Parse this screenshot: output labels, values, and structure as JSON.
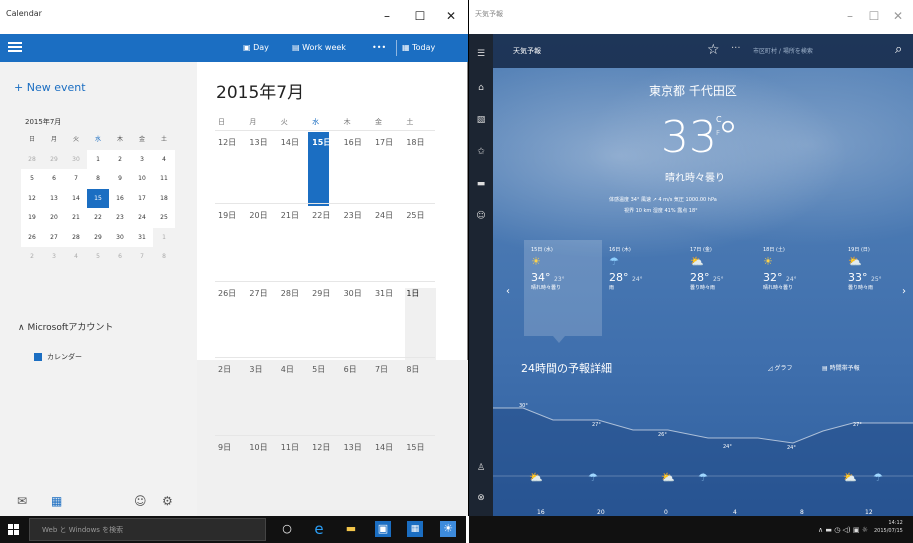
{
  "calendar": {
    "window_title": "Calendar",
    "toolbar": {
      "day": "Day",
      "work_week": "Work week",
      "more": "•••",
      "today": "Today"
    },
    "new_event": "+ New event",
    "mini_title": "2015年7月",
    "weekday_headers": [
      "日",
      "月",
      "火",
      "水",
      "木",
      "金",
      "土"
    ],
    "mini_rows": [
      [
        "28",
        "29",
        "30",
        "1",
        "2",
        "3",
        "4"
      ],
      [
        "5",
        "6",
        "7",
        "8",
        "9",
        "10",
        "11"
      ],
      [
        "12",
        "13",
        "14",
        "15",
        "16",
        "17",
        "18"
      ],
      [
        "19",
        "20",
        "21",
        "22",
        "23",
        "24",
        "25"
      ],
      [
        "26",
        "27",
        "28",
        "29",
        "30",
        "31",
        "1"
      ],
      [
        "2",
        "3",
        "4",
        "5",
        "6",
        "7",
        "8"
      ]
    ],
    "account": "Microsoftアカウント",
    "calendar_item": "カレンダー",
    "month_title": "2015年7月",
    "week_rows": [
      [
        "12日",
        "13日",
        "14日",
        "15日",
        "16日",
        "17日",
        "18日"
      ],
      [
        "19日",
        "20日",
        "21日",
        "22日",
        "23日",
        "24日",
        "25日"
      ],
      [
        "26日",
        "27日",
        "28日",
        "29日",
        "30日",
        "31日",
        "1日"
      ],
      [
        "2日",
        "3日",
        "4日",
        "5日",
        "6日",
        "7日",
        "8日"
      ],
      [
        "9日",
        "10日",
        "11日",
        "12日",
        "13日",
        "14日",
        "15日"
      ]
    ],
    "accent": "#1b6ec2"
  },
  "weather": {
    "app_name": "天気予報",
    "search_placeholder": "市区町村 / 場所を検索",
    "location": "東京都 千代田区",
    "temperature": "33",
    "degree": "°",
    "unit_c": "C",
    "unit_f": "F",
    "condition": "晴れ時々曇り",
    "detail_line1": "体感温度 34°  風速 ↗ 4 m/s  気圧 1000.00 hPa",
    "detail_line2": "視界 10 km  湿度 41%  露点 18°",
    "days": [
      {
        "name": "15日 (水)",
        "icon": "sun-icon",
        "glyph": "☀",
        "high": "34°",
        "low": "23°",
        "desc": "晴れ時々曇り"
      },
      {
        "name": "16日 (木)",
        "icon": "rain-icon",
        "glyph": "☂",
        "high": "28°",
        "low": "24°",
        "desc": "雨"
      },
      {
        "name": "17日 (金)",
        "icon": "partly-cloudy-icon",
        "glyph": "⛅",
        "high": "28°",
        "low": "25°",
        "desc": "曇り時々雨"
      },
      {
        "name": "18日 (土)",
        "icon": "sun-icon",
        "glyph": "☀",
        "high": "32°",
        "low": "24°",
        "desc": "晴れ時々曇り"
      },
      {
        "name": "19日 (日)",
        "icon": "partly-cloudy-icon",
        "glyph": "⛅",
        "high": "33°",
        "low": "25°",
        "desc": "曇り時々雨"
      }
    ],
    "hourly_title": "24時間の予報詳細",
    "graph_label": "グラフ",
    "hourly_label": "時間帯予報",
    "hour_temps": [
      "30°",
      "27°",
      "26°",
      "24°",
      "24°",
      "27°"
    ],
    "hour_labels": [
      "16",
      "20",
      "0",
      "4",
      "8",
      "12"
    ]
  },
  "taskbar": {
    "search_placeholder": "Web と Windows を検索",
    "clock_time": "14:12",
    "clock_date": "2015/07/15"
  }
}
